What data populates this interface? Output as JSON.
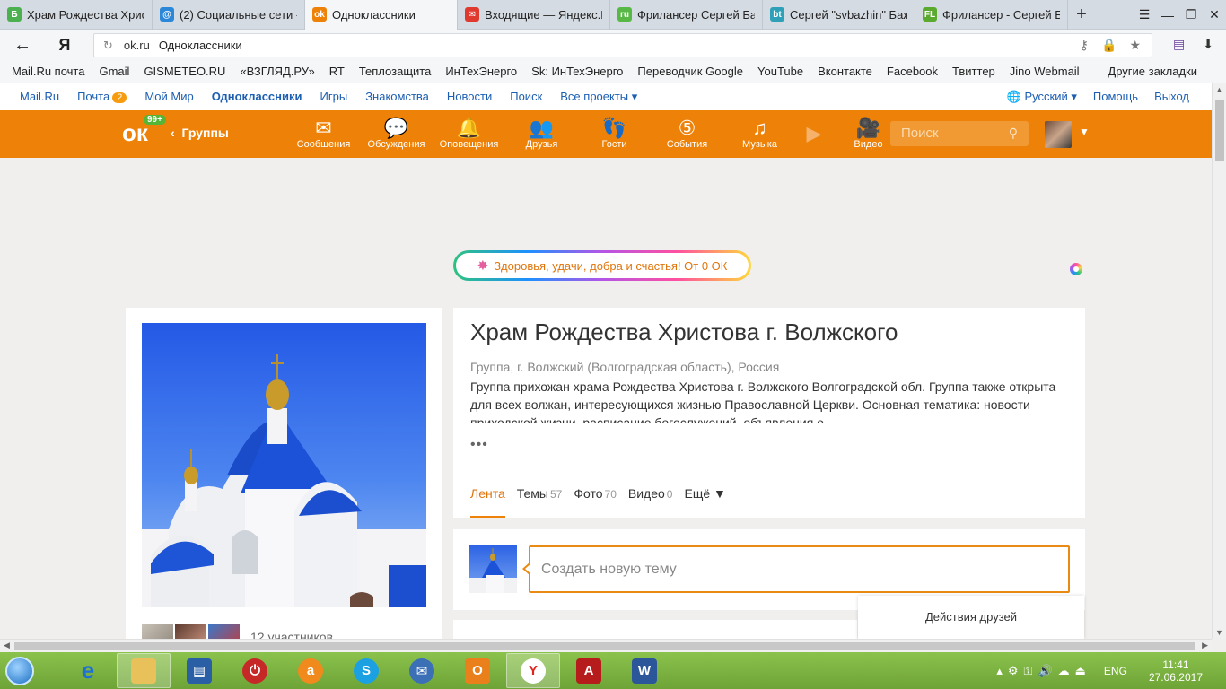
{
  "browser": {
    "tabs": [
      {
        "title": "Храм Рождества Христ",
        "color": "#4caf50",
        "glyph": "Б",
        "active": false
      },
      {
        "title": "(2) Социальные сети -",
        "color": "#2b87d8",
        "glyph": "@",
        "active": false
      },
      {
        "title": "Одноклассники",
        "color": "#ee8208",
        "glyph": "ok",
        "active": true
      },
      {
        "title": "Входящие — Яндекс.П",
        "color": "#e03a2f",
        "glyph": "✉",
        "active": false
      },
      {
        "title": "Фрилансер Сергей Ба",
        "color": "#57b845",
        "glyph": "ru",
        "active": false
      },
      {
        "title": "Сергей \"svbazhin\" Баж",
        "color": "#2ea0b7",
        "glyph": "bt",
        "active": false
      },
      {
        "title": "Фрилансер - Сергей Б",
        "color": "#5aaa2f",
        "glyph": "FL",
        "active": false
      }
    ],
    "new_tab": "+",
    "address": {
      "domain": "ok.ru",
      "title": "Одноклассники"
    },
    "bookmarks": [
      "Mail.Ru почта",
      "Gmail",
      "GISMETEO.RU",
      "«ВЗГЛЯД.РУ»",
      "RT",
      "Теплозащита",
      "ИнТехЭнерго",
      "Sk: ИнТехЭнерго",
      "Переводчик Google",
      "YouTube",
      "Вконтакте",
      "Facebook",
      "Твиттер",
      "Jino Webmail"
    ],
    "other_bookmarks": "Другие закладки"
  },
  "mailru_bar": {
    "links": [
      "Mail.Ru",
      "Почта",
      "Мой Мир",
      "Одноклассники",
      "Игры",
      "Знакомства",
      "Новости",
      "Поиск",
      "Все проекты ▾"
    ],
    "mail_badge": "2",
    "language": "Русский ▾",
    "help": "Помощь",
    "logout": "Выход"
  },
  "ok_header": {
    "notifications": "99+",
    "back_label": "Группы",
    "nav": [
      {
        "label": "Сообщения",
        "icon": "envelope-icon",
        "glyph": "✉"
      },
      {
        "label": "Обсуждения",
        "icon": "chat-bubbles-icon",
        "glyph": "💬"
      },
      {
        "label": "Оповещения",
        "icon": "bell-icon",
        "glyph": "🔔"
      },
      {
        "label": "Друзья",
        "icon": "friends-icon",
        "glyph": "👥"
      },
      {
        "label": "Гости",
        "icon": "footprints-icon",
        "glyph": "👣"
      },
      {
        "label": "События",
        "icon": "events-icon",
        "glyph": "⑤"
      },
      {
        "label": "Музыка",
        "icon": "music-note-icon",
        "glyph": "♫"
      },
      {
        "label": "",
        "icon": "play-icon",
        "glyph": "▶"
      },
      {
        "label": "Видео",
        "icon": "video-camera-icon",
        "glyph": "🎥"
      }
    ],
    "search_placeholder": "Поиск"
  },
  "promo": "Здоровья, удачи, добра и счастья! От 0 ОК",
  "group": {
    "title": "Храм Рождества Христова г. Волжского",
    "subtitle": "Группа, г. Волжский (Волгоградская область), Россия",
    "description": "Группа прихожан храма Рождества Христова г. Волжского Волгоградской обл. Группа также открыта для всех волжан, интересующихся жизнью Православной Церкви. Основная тематика: новости приходской жизни, расписание богослужений, объявления о",
    "more": "•••",
    "tabs": [
      {
        "label": "Лента",
        "count": ""
      },
      {
        "label": "Темы",
        "count": "57"
      },
      {
        "label": "Фото",
        "count": "70"
      },
      {
        "label": "Видео",
        "count": "0"
      },
      {
        "label": "Ещё ▼",
        "count": ""
      }
    ],
    "members_text": "12 участников",
    "new_topic_placeholder": "Создать новую тему"
  },
  "friends_actions": "Действия друзей",
  "taskbar": {
    "language": "ENG",
    "time": "11:41",
    "date": "27.06.2017"
  },
  "colors": {
    "ok_orange": "#ee8208",
    "link_blue": "#1c5fb2",
    "taskbar_green": "#7bb23f"
  }
}
